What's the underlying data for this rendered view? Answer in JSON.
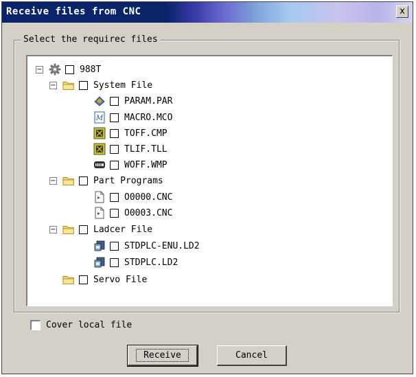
{
  "window": {
    "title": "Receive files from CNC",
    "close_label": "x"
  },
  "group": {
    "legend": "Select the requirec files"
  },
  "tree": {
    "root": {
      "expander": "−",
      "icon": "gear-icon",
      "label": "988T"
    },
    "system": {
      "expander": "−",
      "icon": "folder-icon",
      "label": "System File"
    },
    "param": {
      "icon": "param-file-icon",
      "label": "PARAM.PAR"
    },
    "macro": {
      "icon": "macro-file-icon",
      "label": "MACRO.MCO"
    },
    "toff": {
      "icon": "tool-offset-file-icon",
      "label": "TOFF.CMP"
    },
    "tlif": {
      "icon": "tool-life-file-icon",
      "label": "TLIF.TLL"
    },
    "woff": {
      "icon": "work-offset-file-icon",
      "label": "WOFF.WMP"
    },
    "programs": {
      "expander": "−",
      "icon": "folder-icon",
      "label": "Part Programs"
    },
    "o0000": {
      "icon": "document-icon",
      "label": "O0000.CNC"
    },
    "o0003": {
      "icon": "document-icon",
      "label": "O0003.CNC"
    },
    "ladder": {
      "expander": "−",
      "icon": "folder-icon",
      "label": "Ladcer File"
    },
    "stdplc_enu": {
      "icon": "ladder-file-icon",
      "label": "STDPLC-ENU.LD2"
    },
    "stdplc": {
      "icon": "ladder-file-icon",
      "label": "STDPLC.LD2"
    },
    "servo": {
      "icon": "folder-icon",
      "label": "Servo File"
    }
  },
  "cover": {
    "label": "Cover local file",
    "checked": false
  },
  "buttons": {
    "receive": "Receive",
    "cancel": "Cancel"
  },
  "colors": {
    "title_start": "#0a246a",
    "face": "#d4d0c8",
    "folder": "#f5d76e"
  }
}
